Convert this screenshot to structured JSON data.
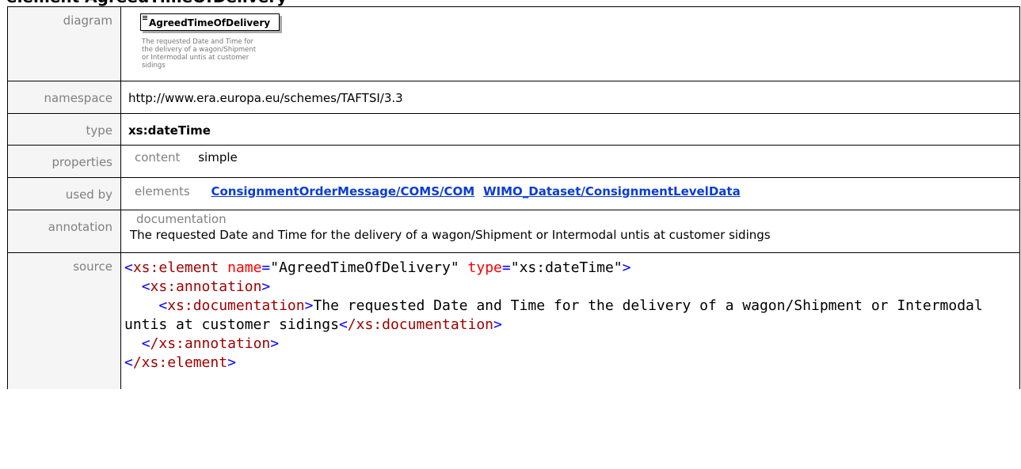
{
  "page_title": "element AgreedTimeOfDelivery",
  "rows": {
    "diagram": {
      "label": "diagram",
      "element_name": "AgreedTimeOfDelivery",
      "element_doc": "The requested Date and Time for the delivery of a wagon/Shipment or Intermodal untis at customer sidings"
    },
    "namespace": {
      "label": "namespace",
      "value": "http://www.era.europa.eu/schemes/TAFTSI/3.3"
    },
    "type": {
      "label": "type",
      "value": "xs:dateTime"
    },
    "properties": {
      "label": "properties",
      "key": "content",
      "value": "simple"
    },
    "used_by": {
      "label": "used by",
      "key": "elements",
      "links": [
        "ConsignmentOrderMessage/COMS/COM",
        "WIMO_Dataset/ConsignmentLevelData"
      ]
    },
    "annotation": {
      "label": "annotation",
      "key": "documentation",
      "value": "The requested Date and Time for the delivery of a wagon/Shipment or Intermodal untis at customer sidings"
    },
    "source": {
      "label": "source",
      "open_tag": "xs:element",
      "attr_name": "name",
      "attr_name_value": "\"AgreedTimeOfDelivery\"",
      "attr_type": "type",
      "attr_type_value": "\"xs:dateTime\"",
      "annotation_tag": "xs:annotation",
      "documentation_tag": "xs:documentation",
      "documentation_text": "The requested Date and Time for the delivery of a wagon/Shipment or Intermodal untis at customer sidings",
      "close_documentation": "/xs:documentation",
      "close_annotation": "/xs:annotation",
      "close_element": "/xs:element"
    }
  }
}
